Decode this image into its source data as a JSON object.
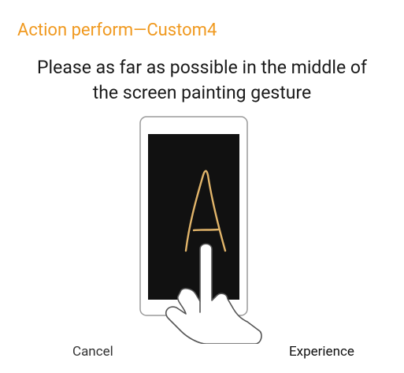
{
  "dialog": {
    "title": "Action perform—Custom4",
    "message_line1": "Please as far as possible in the middle of",
    "message_line2": "the screen painting gesture",
    "cancel_label": "Cancel",
    "experience_label": "Experience"
  },
  "colors": {
    "accent": "#f0991f",
    "gesture_stroke": "#e2b56a",
    "screen": "#111111"
  },
  "illustration": {
    "icon": "phone-gesture-illustration",
    "gesture_letter_icon": "letter-a-gesture-icon",
    "hand_icon": "pointing-hand-icon"
  }
}
